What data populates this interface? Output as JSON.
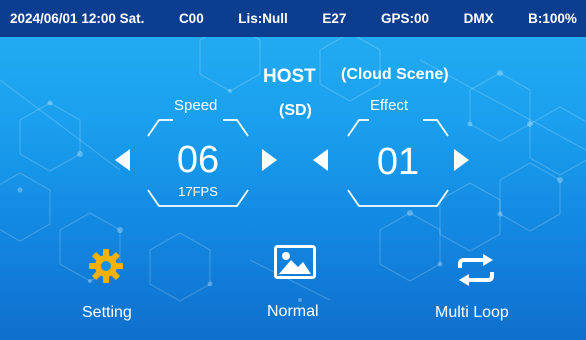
{
  "status_bar": {
    "datetime": "2024/06/01 12:00 Sat.",
    "channel": "C00",
    "lis": "Lis:Null",
    "code": "E27",
    "gps": "GPS:00",
    "dmx": "DMX",
    "battery": "B:100%"
  },
  "mode": {
    "host": "HOST",
    "scene": "(Cloud Scene)",
    "storage": "(SD)"
  },
  "speed": {
    "label": "Speed",
    "value": "06",
    "fps": "17FPS"
  },
  "effect": {
    "label": "Effect",
    "value": "01"
  },
  "buttons": {
    "setting": "Setting",
    "normal": "Normal",
    "loop": "Multi Loop"
  },
  "colors": {
    "status_bar": "#0c3d8f",
    "background": "#1aa0ee",
    "gear": "#f5b300"
  },
  "icons": [
    "gear-icon",
    "image-icon",
    "repeat-icon"
  ]
}
